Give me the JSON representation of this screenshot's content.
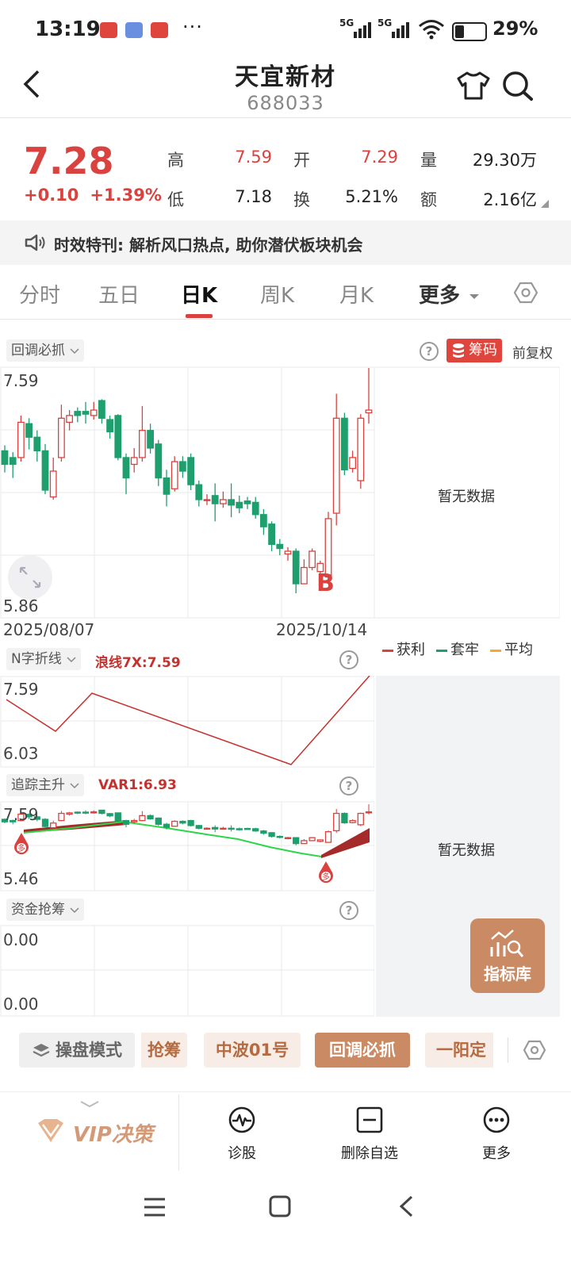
{
  "status_bar": {
    "time": "13:19",
    "more": "···",
    "net1": "5G",
    "net2": "5G",
    "battery": "29%"
  },
  "header": {
    "title": "天宜新材",
    "code": "688033"
  },
  "quote": {
    "price": "7.28",
    "change": "+0.10",
    "change_pct": "+1.39%",
    "stats": [
      {
        "label": "高",
        "value": "7.59",
        "color": "red"
      },
      {
        "label": "开",
        "value": "7.29",
        "color": "red"
      },
      {
        "label": "量",
        "value": "29.30万",
        "color": "black"
      },
      {
        "label": "低",
        "value": "7.18",
        "color": "black"
      },
      {
        "label": "换",
        "value": "5.21%",
        "color": "black"
      },
      {
        "label": "额",
        "value": "2.16亿",
        "color": "black"
      }
    ]
  },
  "notice": {
    "text": "时效特刊: 解析风口热点, 助你潜伏板块机会"
  },
  "tabs": [
    "分时",
    "五日",
    "日K",
    "周K",
    "月K",
    "更多"
  ],
  "main_chart": {
    "indicator": "回调必抓",
    "chip_button": "筹码",
    "adjust": "前复权",
    "y_max": "7.59",
    "y_min": "5.86",
    "date_start": "2025/08/07",
    "date_end": "2025/10/14",
    "signal": "B",
    "no_data": "暂无数据",
    "legend": [
      {
        "label": "获利",
        "color": "#d9423f"
      },
      {
        "label": "套牢",
        "color": "#1f9e6e"
      },
      {
        "label": "平均",
        "color": "#f0a93a"
      }
    ]
  },
  "chart_data": {
    "type": "candlestick",
    "price_range": [
      5.86,
      7.59
    ],
    "dates": [
      "2025/08/07",
      "2025/10/14"
    ],
    "candles": [
      {
        "o": 6.98,
        "c": 6.88,
        "h": 7.02,
        "l": 6.82
      },
      {
        "o": 6.93,
        "c": 6.88,
        "h": 6.97,
        "l": 6.78
      },
      {
        "o": 6.93,
        "c": 7.19,
        "h": 7.24,
        "l": 6.9
      },
      {
        "o": 7.18,
        "c": 7.08,
        "h": 7.22,
        "l": 6.99
      },
      {
        "o": 7.08,
        "c": 6.98,
        "h": 7.13,
        "l": 6.9
      },
      {
        "o": 6.98,
        "c": 6.69,
        "h": 7.03,
        "l": 6.66
      },
      {
        "o": 6.64,
        "c": 6.83,
        "h": 6.93,
        "l": 6.62
      },
      {
        "o": 6.93,
        "c": 7.22,
        "h": 7.32,
        "l": 6.9
      },
      {
        "o": 7.19,
        "c": 7.24,
        "h": 7.28,
        "l": 7.13
      },
      {
        "o": 7.27,
        "c": 7.24,
        "h": 7.3,
        "l": 7.19
      },
      {
        "o": 7.27,
        "c": 7.25,
        "h": 7.34,
        "l": 7.18
      },
      {
        "o": 7.24,
        "c": 7.28,
        "h": 7.34,
        "l": 7.21
      },
      {
        "o": 7.35,
        "c": 7.22,
        "h": 7.36,
        "l": 7.18
      },
      {
        "o": 7.21,
        "c": 7.12,
        "h": 7.24,
        "l": 7.07
      },
      {
        "o": 7.24,
        "c": 6.93,
        "h": 7.25,
        "l": 6.91
      },
      {
        "o": 6.93,
        "c": 6.78,
        "h": 6.96,
        "l": 6.66
      },
      {
        "o": 6.88,
        "c": 6.93,
        "h": 7.0,
        "l": 6.82
      },
      {
        "o": 6.93,
        "c": 7.13,
        "h": 7.31,
        "l": 6.9
      },
      {
        "o": 7.13,
        "c": 7.0,
        "h": 7.18,
        "l": 6.96
      },
      {
        "o": 7.03,
        "c": 6.78,
        "h": 7.06,
        "l": 6.72
      },
      {
        "o": 6.78,
        "c": 6.66,
        "h": 6.84,
        "l": 6.57
      },
      {
        "o": 6.7,
        "c": 6.9,
        "h": 6.94,
        "l": 6.68
      },
      {
        "o": 6.9,
        "c": 6.83,
        "h": 6.94,
        "l": 6.78
      },
      {
        "o": 6.93,
        "c": 6.73,
        "h": 6.96,
        "l": 6.69
      },
      {
        "o": 6.73,
        "c": 6.62,
        "h": 6.76,
        "l": 6.57
      },
      {
        "o": 6.62,
        "c": 6.62,
        "h": 6.66,
        "l": 6.58
      },
      {
        "o": 6.65,
        "c": 6.59,
        "h": 6.74,
        "l": 6.46
      },
      {
        "o": 6.59,
        "c": 6.62,
        "h": 6.68,
        "l": 6.56
      },
      {
        "o": 6.62,
        "c": 6.58,
        "h": 6.74,
        "l": 6.49
      },
      {
        "o": 6.6,
        "c": 6.56,
        "h": 6.65,
        "l": 6.52
      },
      {
        "o": 6.61,
        "c": 6.59,
        "h": 6.64,
        "l": 6.55
      },
      {
        "o": 6.6,
        "c": 6.51,
        "h": 6.64,
        "l": 6.48
      },
      {
        "o": 6.51,
        "c": 6.42,
        "h": 6.55,
        "l": 6.36
      },
      {
        "o": 6.44,
        "c": 6.29,
        "h": 6.46,
        "l": 6.24
      },
      {
        "o": 6.29,
        "c": 6.26,
        "h": 6.33,
        "l": 6.21
      },
      {
        "o": 6.22,
        "c": 6.24,
        "h": 6.27,
        "l": 6.17
      },
      {
        "o": 6.24,
        "c": 6.0,
        "h": 6.26,
        "l": 5.93
      },
      {
        "o": 6.0,
        "c": 6.12,
        "h": 6.18,
        "l": 6.0
      },
      {
        "o": 6.12,
        "c": 6.24,
        "h": 6.26,
        "l": 6.1
      },
      {
        "o": 6.09,
        "c": 6.15,
        "h": 6.17,
        "l": 6.05
      },
      {
        "o": 6.05,
        "c": 6.48,
        "h": 6.53,
        "l": 6.04
      },
      {
        "o": 6.52,
        "c": 7.22,
        "h": 7.4,
        "l": 6.43
      },
      {
        "o": 7.22,
        "c": 6.84,
        "h": 7.26,
        "l": 6.8
      },
      {
        "o": 6.85,
        "c": 6.93,
        "h": 6.98,
        "l": 6.82
      },
      {
        "o": 6.76,
        "c": 7.22,
        "h": 7.25,
        "l": 6.7
      },
      {
        "o": 7.26,
        "c": 7.28,
        "h": 7.59,
        "l": 7.18
      }
    ]
  },
  "n_chart": {
    "indicator": "N字折线",
    "var": "浪线7X:7.59",
    "y_max": "7.59",
    "y_min": "6.03"
  },
  "trend_chart": {
    "indicator": "追踪主升",
    "var": "VAR1:6.93",
    "y_max": "7.59",
    "y_min": "5.46",
    "no_data": "暂无数据",
    "marker": "多"
  },
  "fund_chart": {
    "indicator": "资金抢筹",
    "y_max": "0.00",
    "y_min": "0.00"
  },
  "float_button": {
    "label": "指标库"
  },
  "strategies": [
    {
      "label": "操盘模式",
      "style": "gray"
    },
    {
      "label": "抢筹",
      "style": "normal"
    },
    {
      "label": "中波01号",
      "style": "normal"
    },
    {
      "label": "回调必抓",
      "style": "sel"
    },
    {
      "label": "一阳定",
      "style": "normal"
    }
  ],
  "bottom_bar": {
    "vip": "VIP决策",
    "items": [
      "诊股",
      "删除自选",
      "更多"
    ]
  }
}
